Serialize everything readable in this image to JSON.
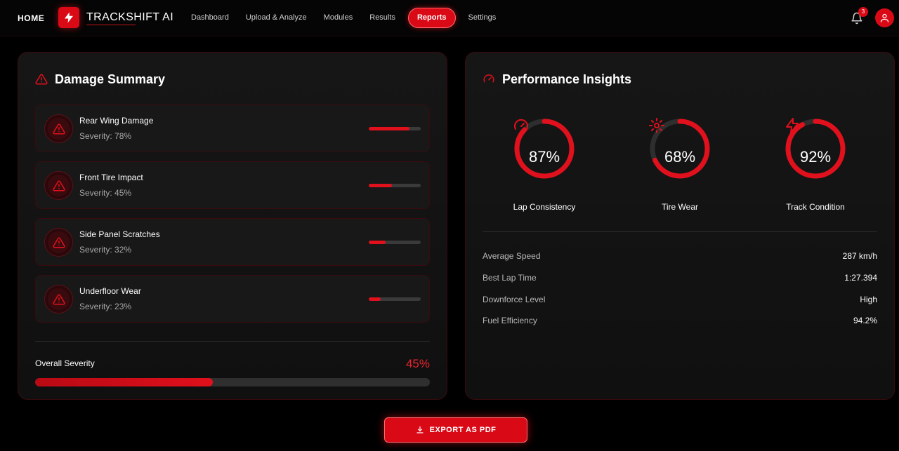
{
  "colors": {
    "accent": "#d90a16",
    "accent_bright": "#e0101c",
    "bg": "#000000",
    "panel": "#141414",
    "track": "#3a3a3a"
  },
  "nav": {
    "home": "HOME",
    "brand": "TRACKSHIFT AI",
    "items": [
      "Dashboard",
      "Upload & Analyze",
      "Modules",
      "Results",
      "Reports",
      "Settings"
    ],
    "active": "Reports",
    "notification_count": "3",
    "icons": [
      "bolt-icon",
      "bell-icon",
      "user-icon"
    ]
  },
  "damage": {
    "title": "Damage Summary",
    "icon": "warning-icon",
    "items": [
      {
        "name": "Rear Wing Damage",
        "severity": "Severity: 78%",
        "value": 78
      },
      {
        "name": "Front Tire Impact",
        "severity": "Severity: 45%",
        "value": 45
      },
      {
        "name": "Side Panel Scratches",
        "severity": "Severity: 32%",
        "value": 32
      },
      {
        "name": "Underfloor Wear",
        "severity": "Severity: 23%",
        "value": 23
      }
    ],
    "overall_label": "Overall Severity",
    "overall_value": "45%",
    "overall_percent": 45
  },
  "performance": {
    "title": "Performance Insights",
    "icon": "speedometer-icon",
    "gauges": [
      {
        "label": "Lap Consistency",
        "value": "87%",
        "percent": 87,
        "icon": "speedometer-icon"
      },
      {
        "label": "Tire Wear",
        "value": "68%",
        "percent": 68,
        "icon": "gear-icon"
      },
      {
        "label": "Track Condition",
        "value": "92%",
        "percent": 92,
        "icon": "bolt-icon"
      }
    ],
    "stats": [
      {
        "label": "Average Speed",
        "value": "287 km/h"
      },
      {
        "label": "Best Lap Time",
        "value": "1:27.394"
      },
      {
        "label": "Downforce Level",
        "value": "High"
      },
      {
        "label": "Fuel Efficiency",
        "value": "94.2%"
      }
    ]
  },
  "export": {
    "label": "EXPORT AS PDF",
    "icon": "download-icon"
  }
}
